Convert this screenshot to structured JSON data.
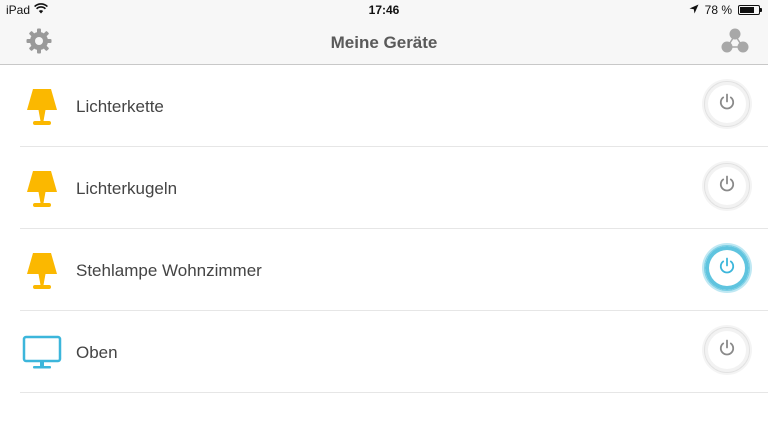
{
  "status_bar": {
    "device": "iPad",
    "time": "17:46",
    "battery": "78 %",
    "battery_level": 0.78
  },
  "nav": {
    "title": "Meine Geräte",
    "left_icon": "gear-icon",
    "right_icon": "network-share-icon"
  },
  "colors": {
    "lamp": "#FBB800",
    "monitor": "#3CB6DB",
    "power_on": "#3CB6DB",
    "power_off": "#8A8A8A"
  },
  "devices": [
    {
      "label": "Lichterkette",
      "icon": "lamp-icon",
      "on": false
    },
    {
      "label": "Lichterkugeln",
      "icon": "lamp-icon",
      "on": false
    },
    {
      "label": "Stehlampe Wohnzimmer",
      "icon": "lamp-icon",
      "on": true
    },
    {
      "label": "Oben",
      "icon": "monitor-icon",
      "on": false
    }
  ]
}
